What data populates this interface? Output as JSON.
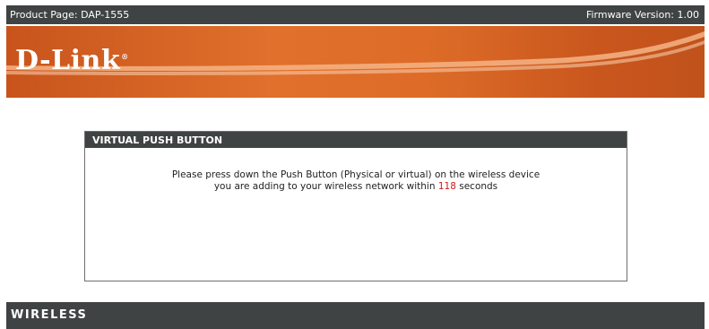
{
  "header": {
    "product_label": "Product Page: DAP-1555",
    "firmware_label": "Firmware Version: 1.00"
  },
  "banner": {
    "logo_text": "D-Link",
    "logo_mark": "®"
  },
  "panel": {
    "title": "VIRTUAL PUSH BUTTON",
    "message_line1": "Please press down the Push Button (Physical or virtual) on the wireless device",
    "message_line2_before": "you are adding to your wireless network within",
    "countdown": "118",
    "message_line2_after": "seconds"
  },
  "footer": {
    "brand": "WIRELESS"
  },
  "colors": {
    "bar": "#404343",
    "banner": "#e0702c",
    "countdown": "#d11a1a"
  }
}
